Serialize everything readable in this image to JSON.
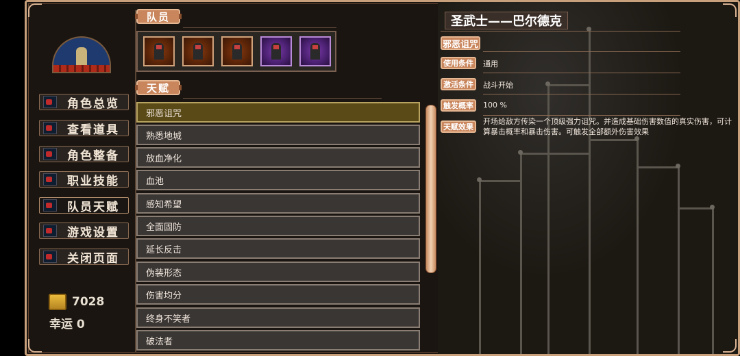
{
  "sidebar": {
    "menu": [
      {
        "label": "角色总览"
      },
      {
        "label": "查看道具"
      },
      {
        "label": "角色整备"
      },
      {
        "label": "职业技能"
      },
      {
        "label": "队员天赋"
      },
      {
        "label": "游戏设置"
      },
      {
        "label": "关闭页面"
      }
    ],
    "gold": "7028",
    "luck": "幸运 0"
  },
  "team": {
    "tag": "队员",
    "members": [
      {
        "icon": "hero-portrait-icon",
        "style": "fire"
      },
      {
        "icon": "hero-portrait-icon",
        "style": "fire"
      },
      {
        "icon": "hero-portrait-icon",
        "style": "fire"
      },
      {
        "icon": "hero-portrait-icon",
        "style": "purple"
      },
      {
        "icon": "hero-portrait-icon",
        "style": "purple"
      }
    ]
  },
  "talent": {
    "tag": "天赋",
    "items": [
      {
        "label": "邪恶诅咒"
      },
      {
        "label": "熟悉地城"
      },
      {
        "label": "放血净化"
      },
      {
        "label": "血池"
      },
      {
        "label": "感知希望"
      },
      {
        "label": "全面固防"
      },
      {
        "label": "延长反击"
      },
      {
        "label": "伪装形态"
      },
      {
        "label": "伤害均分"
      },
      {
        "label": "终身不笑者"
      },
      {
        "label": "破法者"
      }
    ]
  },
  "detail": {
    "character": "圣武士——巴尔德克",
    "skill": "邪恶诅咒",
    "attrs": {
      "use_label": "使用条件",
      "use_value": "通用",
      "activate_label": "激活条件",
      "activate_value": "战斗开始",
      "chance_label": "触发概率",
      "chance_value": "100 %",
      "effect_label": "天赋效果",
      "effect_value": "开场给敌方传染一个顶级强力诅咒。并造成基础伤害数值的真实伤害，可计算暴击概率和暴击伤害。可触发全部额外伤害效果"
    }
  },
  "colors": {
    "accent": "#c9855c",
    "selected_row": "#5a4a18",
    "row": "#3a3634"
  }
}
